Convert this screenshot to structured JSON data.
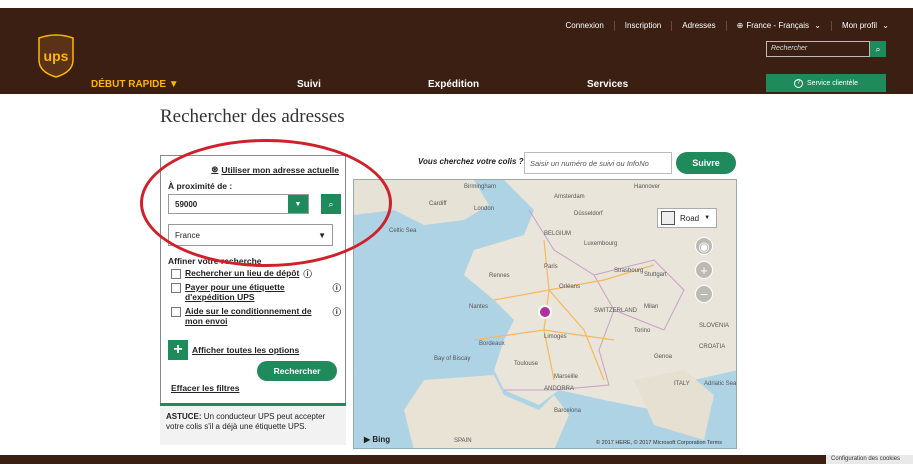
{
  "header": {
    "top_links": [
      "Connexion",
      "Inscription",
      "Adresses",
      "France - Français",
      "Mon profil"
    ],
    "search_placeholder": "Rechercher",
    "service_client": "Service clientèle",
    "nav": {
      "quick_start": "DÉBUT RAPIDE",
      "tracking": "Suivi",
      "shipping": "Expédition",
      "services": "Services"
    }
  },
  "page_title": "Rechercher des adresses",
  "panel": {
    "current_address": "Utiliser mon adresse actuelle",
    "proximity_label": "À proximité de :",
    "zip_value": "59000",
    "country_value": "France",
    "refine_label": "Affiner votre recherche",
    "options": [
      "Rechercher un lieu de dépôt",
      "Payer pour une étiquette d'expédition UPS",
      "Aide sur le conditionnement de mon envoi"
    ],
    "show_all": "Afficher toutes les options",
    "search_button": "Rechercher",
    "clear_filters": "Effacer les filtres",
    "tip_bold": "ASTUCE:",
    "tip_text": "Un conducteur UPS peut accepter votre colis s'il a déjà une étiquette UPS."
  },
  "tracking": {
    "question": "Vous cherchez votre colis ?",
    "placeholder": "Saisir un numéro de suivi ou InfoNo",
    "button": "Suivre"
  },
  "map": {
    "mode": "Road",
    "provider": "Bing",
    "copyright": "© 2017 HERE, © 2017 Microsoft Corporation Terms",
    "places": [
      "Birmingham",
      "London",
      "Cardiff",
      "Amsterdam",
      "Hannover",
      "Düsseldorf",
      "Celtic Sea",
      "BELGIUM",
      "Luxembourg",
      "Paris",
      "Strasbourg",
      "Rennes",
      "Stuttgart",
      "Orléans",
      "Nantes",
      "SWITZERLAND",
      "Milan",
      "Limoges",
      "Bordeaux",
      "Bay of Biscay",
      "Toulouse",
      "Marseille",
      "ANDORRA",
      "ITALY",
      "Barcelona",
      "SPAIN",
      "Genoa",
      "Torino",
      "CROATIA",
      "SLOVENIA",
      "Adriatic Sea"
    ]
  },
  "cookie": "Configuration des cookies",
  "colors": {
    "brand_brown": "#3b1f12",
    "accent_green": "#1f8a5b",
    "gold": "#ffb500",
    "highlight_red": "#d0202a"
  }
}
